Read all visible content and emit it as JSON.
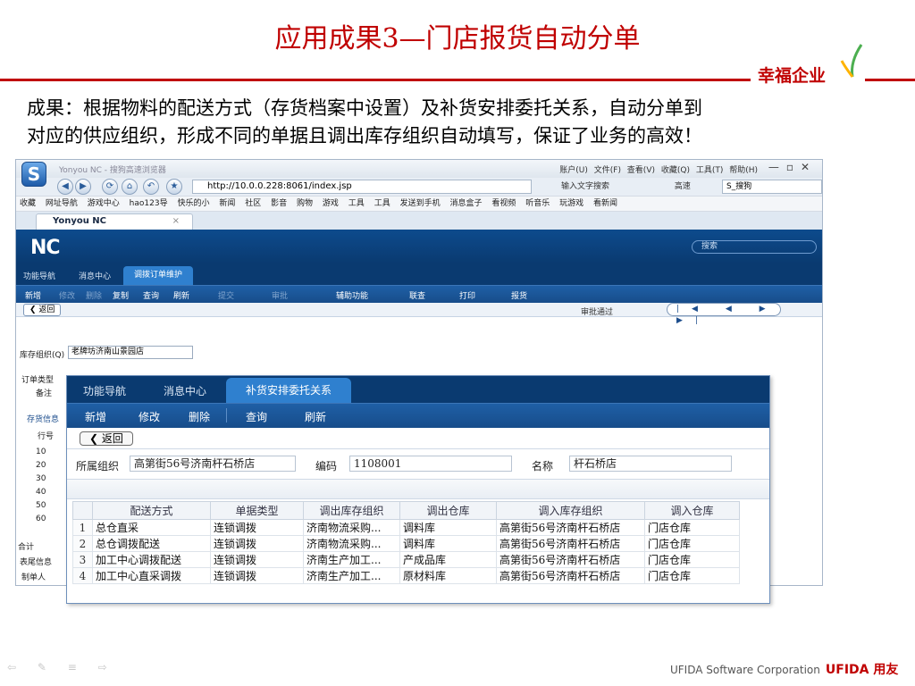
{
  "slide": {
    "title": "应用成果3—门店报货自动分单",
    "brand": "幸福企业",
    "caption_line1": "成果：根据物料的配送方式（存货档案中设置）及补货安排委托关系，自动分单到",
    "caption_line2": "对应的供应组织，形成不同的单据且调出库存组织自动填写，保证了业务的高效！",
    "footer_corp": "UFIDA Software Corporation",
    "footer_logo": "UFIDA 用友",
    "brand_color": "#c00000"
  },
  "browser": {
    "window_title": "Yonyou NC - 搜狗高速浏览器",
    "menu": "账户(U) 文件(F) 查看(V) 收藏(Q) 工具(T) 帮助(H)",
    "url": "http://10.0.0.228:8061/index.jsp",
    "search_hint": "输入文字搜索",
    "speed": "高速",
    "search_engine": "S_搜狗",
    "favorites": [
      "收藏",
      "网址导航",
      "游戏中心",
      "hao123导",
      "快乐的小",
      "新闻",
      "社区",
      "影音",
      "购物",
      "游戏",
      "工具",
      "工具",
      "发送到手机",
      "消息盒子",
      "看视频",
      "听音乐",
      "玩游戏",
      "看新闻"
    ],
    "tab_label": "Yonyou NC"
  },
  "nc": {
    "logo": "NC",
    "search_placeholder": "搜索",
    "tabs": [
      "功能导航",
      "消息中心",
      "调拨订单维护"
    ],
    "toolbar": [
      "新增",
      "修改",
      "删除",
      "复制",
      "查询",
      "刷新",
      "提交",
      "审批",
      "辅助功能",
      "联查",
      "打印",
      "报货"
    ],
    "back": "返回",
    "audit_status": "审批通过",
    "org_label": "库存组织(Q)",
    "org_value": "老牌坊济南山景园店",
    "order_type_label": "订单类型",
    "remark_label": "备注",
    "info_tab": "存货信息",
    "row_header": "行号",
    "row_numbers": [
      "10",
      "20",
      "30",
      "40",
      "50",
      "60"
    ],
    "total_label": "合计",
    "footer_label": "表尾信息",
    "maker_label": "制单人"
  },
  "dialog": {
    "tabs": [
      "功能导航",
      "消息中心",
      "补货安排委托关系"
    ],
    "toolbar": [
      "新增",
      "修改",
      "删除",
      "查询",
      "刷新"
    ],
    "back": "返回",
    "org_label": "所属组织",
    "org_value": "高第街56号济南杆石桥店",
    "code_label": "编码",
    "code_value": "1108001",
    "name_label": "名称",
    "name_value": "杆石桥店",
    "columns": [
      "配送方式",
      "单据类型",
      "调出库存组织",
      "调出仓库",
      "调入库存组织",
      "调入仓库"
    ],
    "rows": [
      [
        "1",
        "总仓直采",
        "连锁调拨",
        "济南物流采购...",
        "调料库",
        "高第街56号济南杆石桥店",
        "门店仓库"
      ],
      [
        "2",
        "总仓调拨配送",
        "连锁调拨",
        "济南物流采购...",
        "调料库",
        "高第街56号济南杆石桥店",
        "门店仓库"
      ],
      [
        "3",
        "加工中心调拨配送",
        "连锁调拨",
        "济南生产加工...",
        "产成品库",
        "高第街56号济南杆石桥店",
        "门店仓库"
      ],
      [
        "4",
        "加工中心直采调拨",
        "连锁调拨",
        "济南生产加工...",
        "原材料库",
        "高第街56号济南杆石桥店",
        "门店仓库"
      ]
    ]
  }
}
